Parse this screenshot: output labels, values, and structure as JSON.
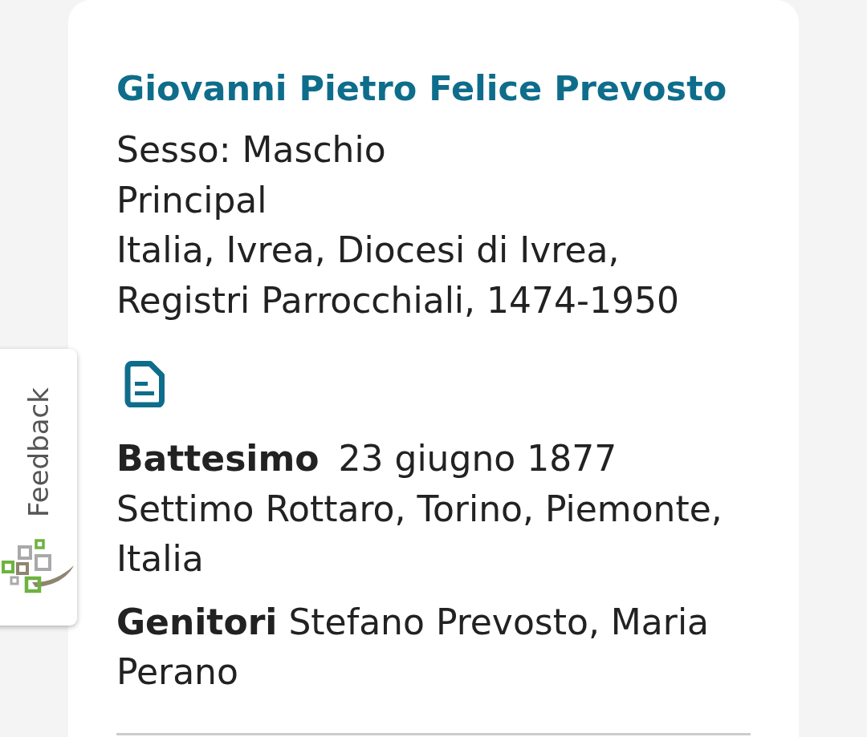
{
  "feedback_tab": {
    "label": "Feedback"
  },
  "record": {
    "name": "Giovanni Pietro Felice Prevosto",
    "details": [
      "Sesso: Maschio",
      "Principal",
      "Italia, Ivrea, Diocesi di Ivrea, Registri Parrocchiali, 1474-1950"
    ]
  },
  "event": {
    "label": "Battesimo",
    "date": "23 giugno 1877",
    "place": "Settimo Rottaro, Torino, Piemonte, Italia"
  },
  "parents": "**Genitori** Stefano Prevosto, Maria Perano"
}
